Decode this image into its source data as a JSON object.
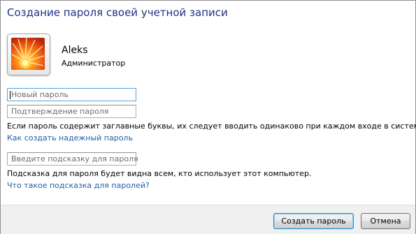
{
  "page": {
    "title": "Создание пароля своей учетной записи"
  },
  "user": {
    "name": "Aleks",
    "role": "Администратор"
  },
  "fields": {
    "new_password": {
      "placeholder": "Новый пароль"
    },
    "confirm_password": {
      "placeholder": "Подтверждение пароля"
    },
    "hint": {
      "placeholder": "Введите подсказку для пароля"
    }
  },
  "texts": {
    "case_warning": "Если пароль содержит заглавные буквы, их следует вводить одинаково при каждом входе в систему.",
    "hint_warning": "Подсказка для пароля будет видна всем, кто использует этот компьютер."
  },
  "links": {
    "strong_password": "Как создать надежный пароль",
    "what_is_hint": "Что такое подсказка для паролей?"
  },
  "buttons": {
    "create": "Создать пароль",
    "cancel": "Отмена"
  },
  "colors": {
    "title": "#1e3287",
    "link": "#1e5fa8",
    "footer": "#f0f0f0"
  }
}
